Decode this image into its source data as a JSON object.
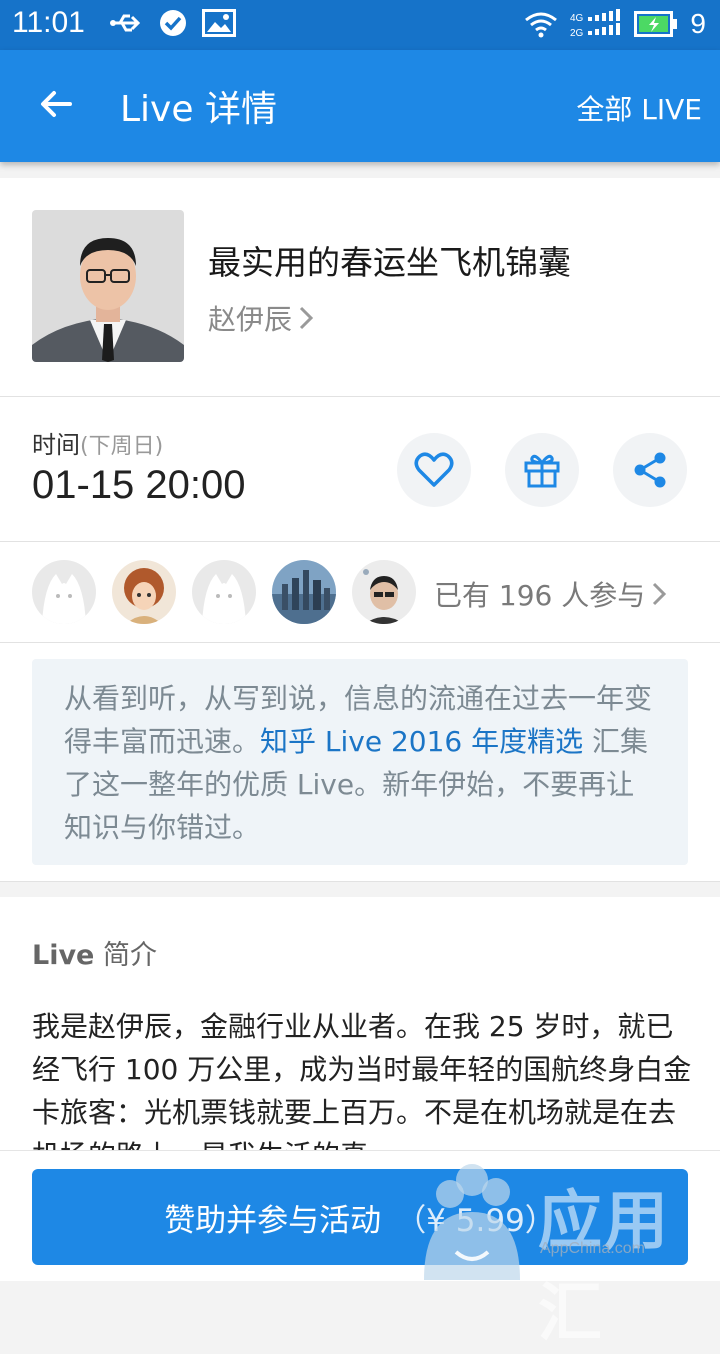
{
  "status_bar": {
    "time": "11:01",
    "battery_level": "9",
    "network_labels": [
      "4G",
      "2G"
    ]
  },
  "app_bar": {
    "title": "Live 详情",
    "all_live": "全部 LIVE"
  },
  "live": {
    "title": "最实用的春运坐飞机锦囊",
    "speaker": "赵伊辰"
  },
  "schedule": {
    "label": "时间",
    "day": "(下周日)",
    "datetime": "01-15 20:00"
  },
  "participants": {
    "count_text": "已有 196 人参与"
  },
  "promo": {
    "text_before": "从看到听，从写到说，信息的流通在过去一年变得丰富而迅速。",
    "link": "知乎 Live 2016 年度精选",
    "text_after": " 汇集了这一整年的优质 Live。新年伊始，不要再让知识与你错过。"
  },
  "intro": {
    "heading_en": "Live",
    "heading_cn": " 简介",
    "body": "我是赵伊辰，金融行业从业者。在我 25 岁时，就已经飞行 100 万公里，成为当时最年轻的国航终身白金卡旅客：光机票钱就要上百万。不是在机场就是在去机场的路上，是我生活的真"
  },
  "cta": {
    "label": "赞助并参与活动",
    "price": "（¥ 5.99）"
  },
  "watermark": {
    "text": "应用汇",
    "sub": "AppChina.com"
  },
  "colors": {
    "primary": "#1e88e5",
    "status": "#1673c9",
    "link": "#1b75c6"
  }
}
